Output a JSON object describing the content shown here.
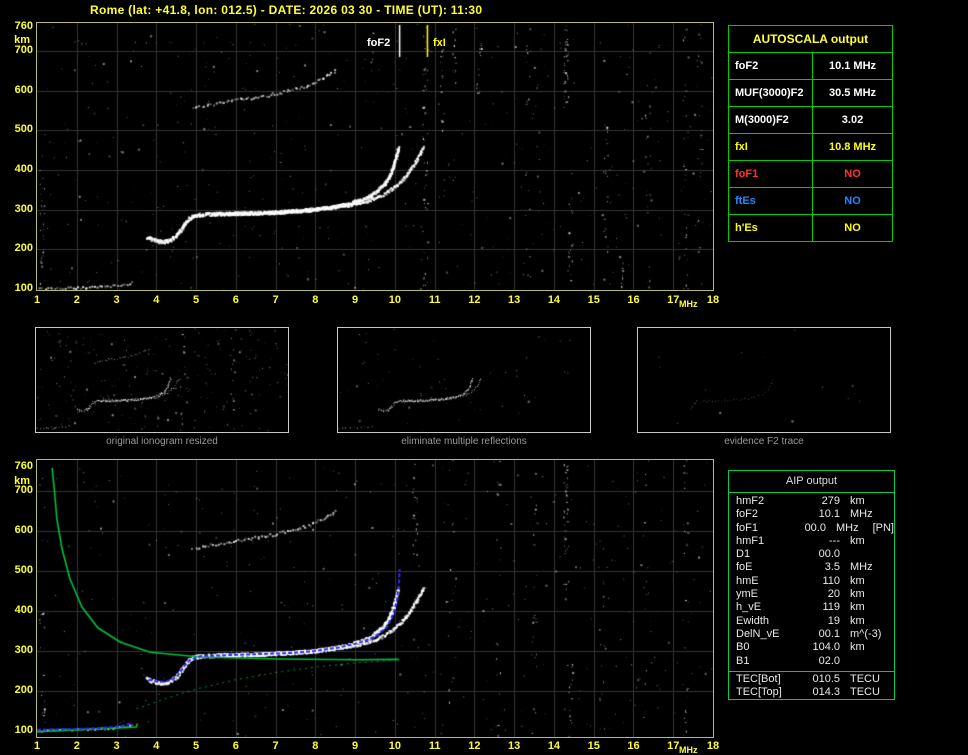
{
  "title": "Rome (lat: +41.8, lon: 012.5) - DATE: 2026 03 30 - TIME (UT): 11:30",
  "colors": {
    "background": "#000000",
    "axis_text": "#ffff33",
    "frame": "#b9b96a",
    "grid": "#343434",
    "trace_white": "#ffffff",
    "profile_green": "#00c040",
    "restored_blue": "#2a2aff",
    "fof2_marker": "#ffffff",
    "fxi_marker": "#ffff00",
    "caption_gray": "#9a9a9a",
    "table_border_green": "#00cc00"
  },
  "autoscala": {
    "header": "AUTOSCALA output",
    "rows": [
      {
        "label": "foF2",
        "value": "10.1 MHz",
        "color": "#ffffff"
      },
      {
        "label": "MUF(3000)F2",
        "value": "30.5 MHz",
        "color": "#ffffff"
      },
      {
        "label": "M(3000)F2",
        "value": "3.02",
        "color": "#ffffff"
      },
      {
        "label": "fxI",
        "value": "10.8 MHz",
        "color": "#ffff00"
      },
      {
        "label": "foF1",
        "value": "NO",
        "color": "#ff3333"
      },
      {
        "label": "ftEs",
        "value": "NO",
        "color": "#2288ff"
      },
      {
        "label": "h'Es",
        "value": "NO",
        "color": "#ffff00"
      }
    ]
  },
  "aip": {
    "header": "AIP output",
    "rows": [
      {
        "name": "hmF2",
        "value": "279",
        "unit": "km",
        "note": ""
      },
      {
        "name": "foF2",
        "value": "10.1",
        "unit": "MHz",
        "note": ""
      },
      {
        "name": "foF1",
        "value": "00.0",
        "unit": "MHz",
        "note": "[PN]"
      },
      {
        "name": "hmF1",
        "value": "---",
        "unit": "km",
        "note": ""
      },
      {
        "name": "D1",
        "value": "00.0",
        "unit": "",
        "note": ""
      },
      {
        "name": "foE",
        "value": "3.5",
        "unit": "MHz",
        "note": ""
      },
      {
        "name": "hmE",
        "value": "110",
        "unit": "km",
        "note": ""
      },
      {
        "name": "ymE",
        "value": "20",
        "unit": "km",
        "note": ""
      },
      {
        "name": "h_vE",
        "value": "119",
        "unit": "km",
        "note": ""
      },
      {
        "name": "Ewidth",
        "value": "19",
        "unit": "km",
        "note": ""
      },
      {
        "name": "DelN_vE",
        "value": "00.1",
        "unit": "m^(-3)",
        "note": ""
      },
      {
        "name": "B0",
        "value": "104.0",
        "unit": "km",
        "note": ""
      },
      {
        "name": "B1",
        "value": "02.0",
        "unit": "",
        "note": ""
      }
    ],
    "tec_rows": [
      {
        "name": "TEC[Bot]",
        "value": "010.5",
        "unit": "TECU"
      },
      {
        "name": "TEC[Top]",
        "value": "014.3",
        "unit": "TECU"
      }
    ]
  },
  "panels": [
    {
      "caption": "original ionogram resized"
    },
    {
      "caption": "eliminate multiple reflections"
    },
    {
      "caption": "evidence F2 trace"
    }
  ],
  "chart_data": {
    "type": "scatter",
    "xlabel": "MHz",
    "ylabel": "km",
    "xlim": [
      1,
      18
    ],
    "ylim": [
      100,
      760
    ],
    "grid": true,
    "x_ticks": [
      1,
      2,
      3,
      4,
      5,
      6,
      7,
      8,
      9,
      10,
      11,
      12,
      13,
      14,
      15,
      16,
      17,
      18
    ],
    "y_ticks": [
      760,
      700,
      600,
      500,
      400,
      300,
      200,
      100
    ],
    "markers": {
      "foF2_label": "foF2",
      "foF2_MHz": 10.1,
      "fxI_label": "fxI",
      "fxI_MHz": 10.8
    },
    "traces": {
      "o_trace": [
        [
          3.75,
          232
        ],
        [
          3.9,
          226
        ],
        [
          4.05,
          222
        ],
        [
          4.2,
          221
        ],
        [
          4.35,
          226
        ],
        [
          4.5,
          238
        ],
        [
          4.62,
          254
        ],
        [
          4.72,
          268
        ],
        [
          4.82,
          280
        ],
        [
          4.95,
          287
        ],
        [
          5.2,
          290
        ],
        [
          5.6,
          291
        ],
        [
          6,
          292
        ],
        [
          6.4,
          293
        ],
        [
          6.8,
          294
        ],
        [
          7.2,
          296
        ],
        [
          7.6,
          299
        ],
        [
          8,
          303
        ],
        [
          8.4,
          308
        ],
        [
          8.8,
          316
        ],
        [
          9.1,
          325
        ],
        [
          9.35,
          336
        ],
        [
          9.55,
          350
        ],
        [
          9.72,
          366
        ],
        [
          9.85,
          386
        ],
        [
          9.95,
          412
        ],
        [
          10.02,
          438
        ],
        [
          10.07,
          460
        ]
      ],
      "x_trace": [
        [
          5.4,
          291
        ],
        [
          5.9,
          292
        ],
        [
          6.4,
          293
        ],
        [
          7,
          295
        ],
        [
          7.5,
          298
        ],
        [
          8,
          302
        ],
        [
          8.5,
          308
        ],
        [
          9,
          316
        ],
        [
          9.4,
          327
        ],
        [
          9.7,
          340
        ],
        [
          9.95,
          356
        ],
        [
          10.15,
          374
        ],
        [
          10.35,
          398
        ],
        [
          10.5,
          422
        ],
        [
          10.62,
          444
        ],
        [
          10.72,
          462
        ]
      ],
      "second_hop": [
        [
          4.9,
          555
        ],
        [
          5.3,
          566
        ],
        [
          5.8,
          575
        ],
        [
          6.3,
          582
        ],
        [
          6.8,
          590
        ],
        [
          7.3,
          601
        ],
        [
          7.8,
          615
        ],
        [
          8.2,
          633
        ],
        [
          8.55,
          655
        ]
      ],
      "e_trace": [
        [
          1.05,
          103
        ],
        [
          1.5,
          104
        ],
        [
          2,
          105
        ],
        [
          2.5,
          107
        ],
        [
          2.95,
          110
        ],
        [
          3.25,
          114
        ],
        [
          3.45,
          120
        ]
      ]
    },
    "profile": {
      "topside": [
        [
          1.38,
          758
        ],
        [
          1.44,
          700
        ],
        [
          1.5,
          630
        ],
        [
          1.63,
          555
        ],
        [
          1.83,
          480
        ],
        [
          2.13,
          410
        ],
        [
          2.53,
          358
        ],
        [
          3.1,
          322
        ],
        [
          3.85,
          297
        ],
        [
          5.1,
          285
        ],
        [
          7.1,
          280
        ],
        [
          9.1,
          278
        ],
        [
          10.1,
          279
        ]
      ],
      "bottomside": [
        [
          3.5,
          155
        ],
        [
          4.2,
          180
        ],
        [
          5,
          205
        ],
        [
          6,
          228
        ],
        [
          7,
          246
        ],
        [
          8,
          260
        ],
        [
          9,
          270
        ],
        [
          9.7,
          275
        ],
        [
          10.1,
          279
        ]
      ],
      "e_region": [
        [
          1,
          98
        ],
        [
          1.6,
          101
        ],
        [
          2.2,
          104
        ],
        [
          2.8,
          107
        ],
        [
          3.3,
          109
        ],
        [
          3.5,
          110
        ],
        [
          3.52,
          119
        ]
      ]
    },
    "restored_trace": {
      "f_trace": [
        [
          3.8,
          228
        ],
        [
          4,
          224
        ],
        [
          4.2,
          223
        ],
        [
          4.4,
          228
        ],
        [
          4.55,
          240
        ],
        [
          4.7,
          262
        ],
        [
          4.85,
          278
        ],
        [
          5.1,
          287
        ],
        [
          5.6,
          289
        ],
        [
          6.2,
          291
        ],
        [
          6.8,
          293
        ],
        [
          7.4,
          295
        ],
        [
          8,
          300
        ],
        [
          8.6,
          309
        ],
        [
          9.1,
          320
        ],
        [
          9.5,
          336
        ],
        [
          9.8,
          360
        ],
        [
          9.95,
          390
        ],
        [
          10.05,
          425
        ],
        [
          10.1,
          468
        ],
        [
          10.12,
          505
        ]
      ],
      "e_trace": [
        [
          1,
          103
        ],
        [
          1.5,
          104
        ],
        [
          2,
          105
        ],
        [
          2.5,
          107
        ],
        [
          2.9,
          110
        ],
        [
          3.2,
          114
        ],
        [
          3.4,
          121
        ]
      ]
    }
  }
}
